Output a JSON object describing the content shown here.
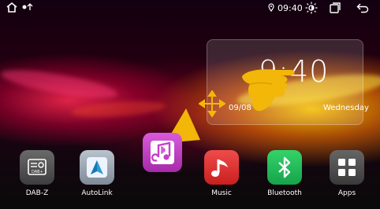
{
  "status_bar": {
    "home_icon": "home-icon",
    "notif_icons": "notification-icons",
    "location_icon": "location-icon",
    "time": "09:40",
    "brightness_icon": "brightness-icon",
    "recents_icon": "recents-icon",
    "back_icon": "back-icon"
  },
  "clock_widget": {
    "time": "9:40",
    "date_visible": "09/08",
    "day": "Wednesday"
  },
  "apps": [
    {
      "label": "DAB-Z",
      "icon": "radio-icon",
      "color": "#5d5d5d"
    },
    {
      "label": "AutoLink",
      "icon": "autolink-icon",
      "color": "#9aa6b3"
    },
    {
      "label": "",
      "icon": "bluetooth-music-icon",
      "color": "#c640c9"
    },
    {
      "label": "Music",
      "icon": "music-note-icon",
      "color": "#e53935"
    },
    {
      "label": "Bluetooth",
      "icon": "bluetooth-icon",
      "color": "#22c55e"
    },
    {
      "label": "Apps",
      "icon": "apps-grid-icon",
      "color": "#5a5a5a"
    }
  ]
}
